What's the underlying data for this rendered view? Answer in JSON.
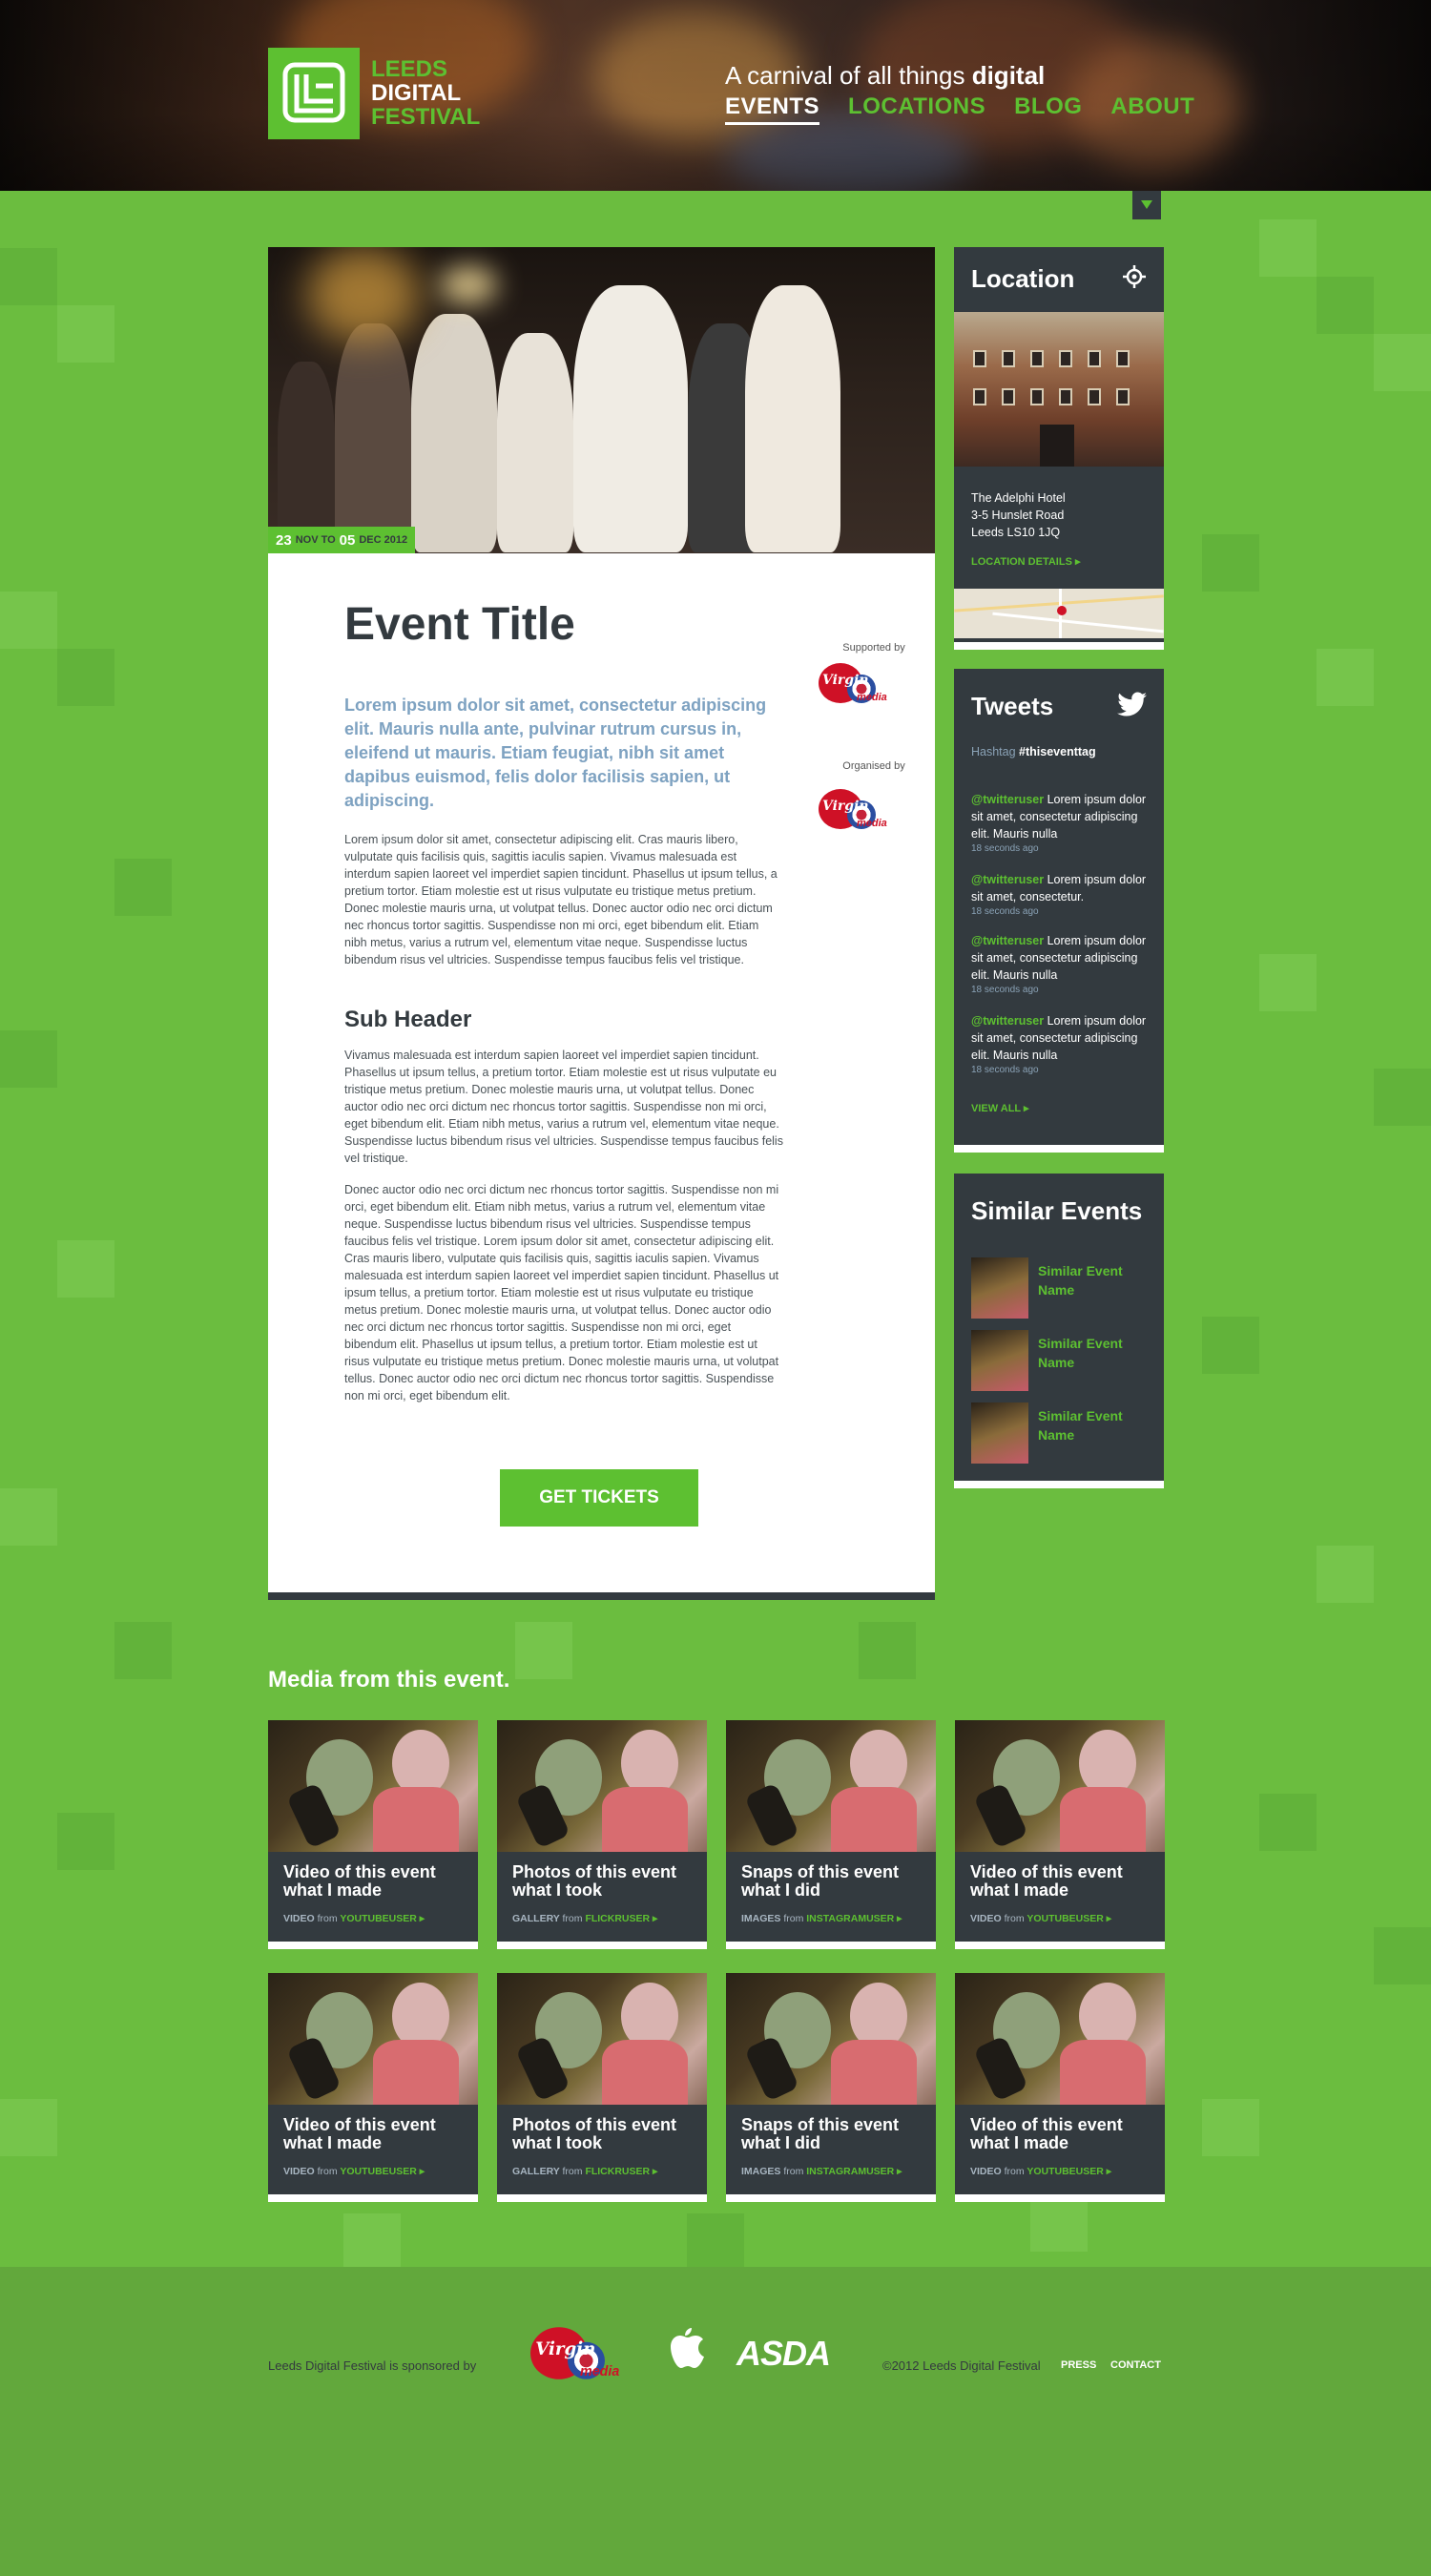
{
  "header": {
    "logo_lines": [
      "LEEDS",
      "DIGITAL",
      "FESTIVAL"
    ],
    "tagline_prefix": "A carnival of all things ",
    "tagline_bold": "digital",
    "nav": [
      {
        "label": "EVENTS",
        "active": true
      },
      {
        "label": "LOCATIONS",
        "active": false
      },
      {
        "label": "BLOG",
        "active": false
      },
      {
        "label": "ABOUT",
        "active": false
      }
    ]
  },
  "event": {
    "date": {
      "start_day": "23",
      "start_month": "NOV TO",
      "end_day": "05",
      "end_month": "DEC 2012"
    },
    "title": "Event Title",
    "lede": "Lorem ipsum dolor sit amet, consectetur adipiscing elit. Mauris nulla ante, pulvinar rutrum cursus in, eleifend ut mauris. Etiam feugiat, nibh sit amet dapibus euismod, felis dolor facilisis sapien, ut adipiscing.",
    "paragraph_1": "Lorem ipsum dolor sit amet, consectetur adipiscing elit. Cras mauris libero, vulputate quis facilisis quis, sagittis iaculis sapien. Vivamus malesuada est interdum sapien laoreet vel imperdiet sapien tincidunt. Phasellus ut ipsum tellus, a pretium tortor. Etiam molestie est ut risus vulputate eu tristique metus pretium. Donec molestie mauris urna, ut volutpat tellus. Donec auctor odio nec orci dictum nec rhoncus tortor sagittis. Suspendisse non mi orci, eget bibendum elit. Etiam nibh metus, varius a rutrum vel, elementum vitae neque. Suspendisse luctus bibendum risus vel ultricies. Suspendisse tempus faucibus felis vel tristique.",
    "sub_header": "Sub Header",
    "paragraph_2": "Vivamus malesuada est interdum sapien laoreet vel imperdiet sapien tincidunt. Phasellus ut ipsum tellus, a pretium tortor. Etiam molestie est ut risus vulputate eu tristique metus pretium. Donec molestie mauris urna, ut volutpat tellus. Donec auctor odio nec orci dictum nec rhoncus tortor sagittis. Suspendisse non mi orci, eget bibendum elit. Etiam nibh metus, varius a rutrum vel, elementum vitae neque. Suspendisse luctus bibendum risus vel ultricies. Suspendisse tempus faucibus felis vel tristique.",
    "paragraph_3": "Donec auctor odio nec orci dictum nec rhoncus tortor sagittis. Suspendisse non mi orci, eget bibendum elit. Etiam nibh metus, varius a rutrum vel, elementum vitae neque. Suspendisse luctus bibendum risus vel ultricies. Suspendisse tempus faucibus felis vel tristique. Lorem ipsum dolor sit amet, consectetur adipiscing elit. Cras mauris libero, vulputate quis facilisis quis, sagittis iaculis sapien. Vivamus malesuada est interdum sapien laoreet vel imperdiet sapien tincidunt. Phasellus ut ipsum tellus, a pretium tortor. Etiam molestie est ut risus vulputate eu tristique metus pretium. Donec molestie mauris urna, ut volutpat tellus. Donec auctor odio nec orci dictum nec rhoncus tortor sagittis. Suspendisse non mi orci, eget bibendum elit. Phasellus ut ipsum tellus, a pretium tortor. Etiam molestie est ut risus vulputate eu tristique metus pretium. Donec molestie mauris urna, ut volutpat tellus. Donec auctor odio nec orci dictum nec rhoncus tortor sagittis. Suspendisse non mi orci, eget bibendum elit.",
    "tickets_label": "GET TICKETS",
    "supported_by": "Supported by",
    "organised_by": "Organised by",
    "sponsor_logo_text": {
      "virgin": "Virgin",
      "media": "media"
    }
  },
  "location": {
    "title": "Location",
    "address": [
      "The Adelphi Hotel",
      "3-5 Hunslet Road",
      "Leeds LS10 1JQ"
    ],
    "details_link": "LOCATION DETAILS ▸"
  },
  "tweets": {
    "title": "Tweets",
    "hashtag_label": "Hashtag",
    "hashtag": "#thiseventtag",
    "items": [
      {
        "user": "@twitteruser",
        "text": "Lorem ipsum dolor sit amet, consectetur adipiscing elit. Mauris nulla",
        "time": "18 seconds ago"
      },
      {
        "user": "@twitteruser",
        "text": "Lorem ipsum dolor sit amet, consectetur.",
        "time": "18 seconds ago"
      },
      {
        "user": "@twitteruser",
        "text": "Lorem ipsum dolor sit amet, consectetur adipiscing elit. Mauris nulla",
        "time": "18 seconds ago"
      },
      {
        "user": "@twitteruser",
        "text": "Lorem ipsum dolor sit amet, consectetur adipiscing elit. Mauris nulla",
        "time": "18 seconds ago"
      }
    ],
    "view_all": "VIEW ALL ▸"
  },
  "similar_events": {
    "title": "Similar Events",
    "items": [
      "Similar Event Name",
      "Similar Event Name",
      "Similar Event Name"
    ]
  },
  "media": {
    "heading": "Media from this event.",
    "items": [
      {
        "title": "Video of this event what I made",
        "type": "VIDEO",
        "from": "from",
        "source": "YOUTUBEUSER ▸"
      },
      {
        "title": "Photos of this event what I took",
        "type": "GALLERY",
        "from": "from",
        "source": "FLICKRUSER ▸"
      },
      {
        "title": "Snaps of this event what I did",
        "type": "IMAGES",
        "from": "from",
        "source": "INSTAGRAMUSER ▸"
      },
      {
        "title": "Video of this event what I made",
        "type": "VIDEO",
        "from": "from",
        "source": "YOUTUBEUSER ▸"
      },
      {
        "title": "Video of this event what I made",
        "type": "VIDEO",
        "from": "from",
        "source": "YOUTUBEUSER ▸"
      },
      {
        "title": "Photos of this event what I took",
        "type": "GALLERY",
        "from": "from",
        "source": "FLICKRUSER ▸"
      },
      {
        "title": "Snaps of this event what I did",
        "type": "IMAGES",
        "from": "from",
        "source": "INSTAGRAMUSER ▸"
      },
      {
        "title": "Video of this event what I made",
        "type": "VIDEO",
        "from": "from",
        "source": "YOUTUBEUSER ▸"
      }
    ]
  },
  "footer": {
    "sponsored_by": "Leeds Digital Festival is sponsored by",
    "asda": "ASDA",
    "copyright": "©2012 Leeds Digital Festival",
    "links": [
      "PRESS",
      "CONTACT"
    ]
  },
  "colors": {
    "brand_green": "#5dc031",
    "dark": "#333a3f",
    "background": "#6bbd3f",
    "lede_blue": "#7ea2c1"
  }
}
